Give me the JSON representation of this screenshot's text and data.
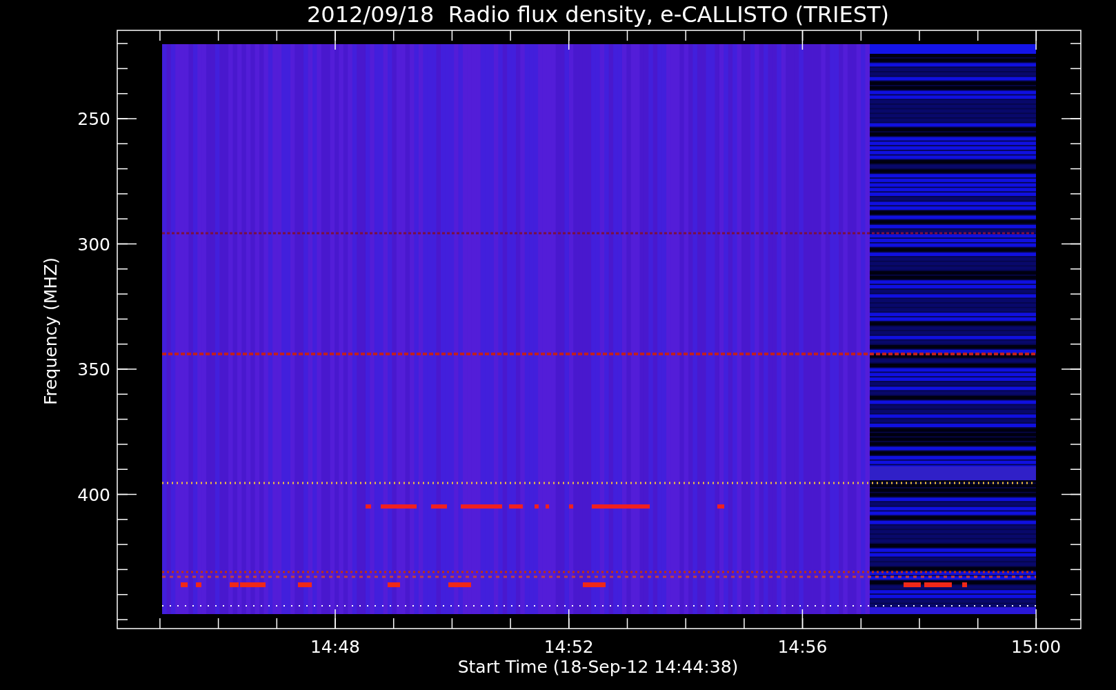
{
  "title": "2012/09/18  Radio flux density, e-CALLISTO (TRIEST)",
  "y_axis": {
    "label": "Frequency (MHZ)",
    "ticks": [
      "250",
      "300",
      "350",
      "400"
    ]
  },
  "x_axis": {
    "label": "Start Time (18-Sep-12 14:44:38)",
    "ticks": [
      "14:48",
      "14:52",
      "14:56",
      "15:00"
    ]
  }
}
